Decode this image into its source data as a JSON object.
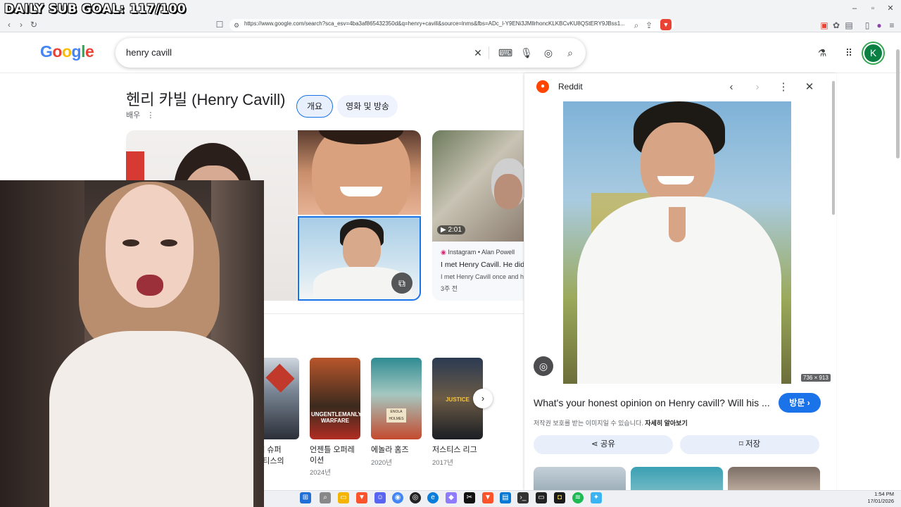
{
  "overlay": {
    "sub_goal": "DAILY SUB GOAL: 117/100"
  },
  "browser": {
    "url": "https://www.google.com/search?sca_esv=4ba3af865432350d&q=henry+cavill&source=lnms&fbs=ADc_l-Y9ENi3JMllrhoncKLKBCvKU8QStERY9JBss1..."
  },
  "google": {
    "logo": [
      "G",
      "o",
      "o",
      "g",
      "l",
      "e"
    ],
    "query": "henry cavill",
    "avatar_letter": "K"
  },
  "knowledge_panel": {
    "title": "헨리 카빌 (Henry Cavill)",
    "subtitle": "배우",
    "chips": [
      "개요",
      "영화 및 방송"
    ]
  },
  "video_result": {
    "duration": "▶ 2:01",
    "source": "Instagram • Alan Powell",
    "title": "I met Henry Cavill. He did",
    "snippet": "I met Henry Cavill once and h",
    "age": "3주 전"
  },
  "movies": [
    {
      "title": "맨 대 슈퍼",
      "title2": "저스티스의",
      "year": ""
    },
    {
      "title": "언젠틀 오퍼레",
      "title2": "이션",
      "year": "2024년"
    },
    {
      "title": "에놀라 홈즈",
      "title2": "",
      "year": "2020년"
    },
    {
      "title": "저스티스 리그",
      "title2": "",
      "year": "2017년"
    }
  ],
  "movies_tail": "년",
  "preview_panel": {
    "source": "Reddit",
    "image_size": "736 × 913",
    "title": "What's your honest opinion on Henry cavill? Will his ...",
    "visit_label": "방문 ›",
    "copyright": "저작권 보호를 받는 이미지일 수 있습니다.",
    "learn_more": "자세히 알아보기",
    "share_label": "공유",
    "save_label": "저장"
  },
  "clock": {
    "time": "1:54 PM",
    "date": "17/01/2026"
  },
  "colors": {
    "accent": "#1a73e8",
    "reddit": "#ff4500",
    "chip_bg": "#e8f0fe"
  }
}
